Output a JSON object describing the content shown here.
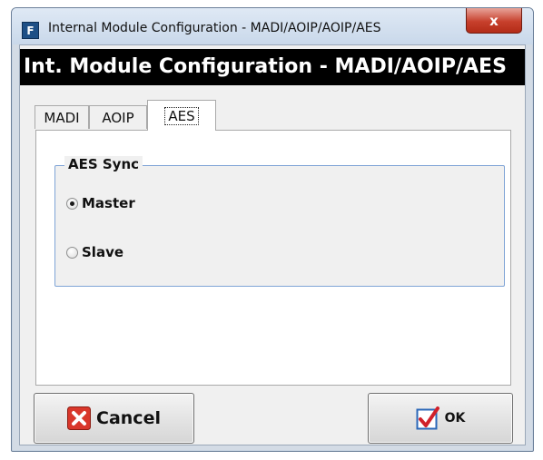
{
  "window": {
    "title": "Internal Module Configuration - MADI/AOIP/AOIP/AES",
    "app_icon_glyph": "F",
    "close_glyph": "x"
  },
  "header": {
    "text": "Int. Module Configuration - MADI/AOIP/AES"
  },
  "tabs": [
    {
      "label": "MADI",
      "active": false
    },
    {
      "label": "AOIP",
      "active": false
    },
    {
      "label": "AES",
      "active": true
    }
  ],
  "aes_sync": {
    "group_title": "AES Sync",
    "options": [
      {
        "label": "Master",
        "selected": true
      },
      {
        "label": "Slave",
        "selected": false
      }
    ]
  },
  "buttons": {
    "cancel_label": "Cancel",
    "ok_label": "OK",
    "cancel_icon": "cancel-x-icon",
    "ok_icon": "checkbox-check-icon"
  },
  "colors": {
    "header_bg": "#000000",
    "close_button": "#c7402c",
    "group_border": "#7fa4d6",
    "cancel_icon": "#d9372b",
    "ok_check": "#d0202a",
    "ok_box": "#2b67b8"
  }
}
